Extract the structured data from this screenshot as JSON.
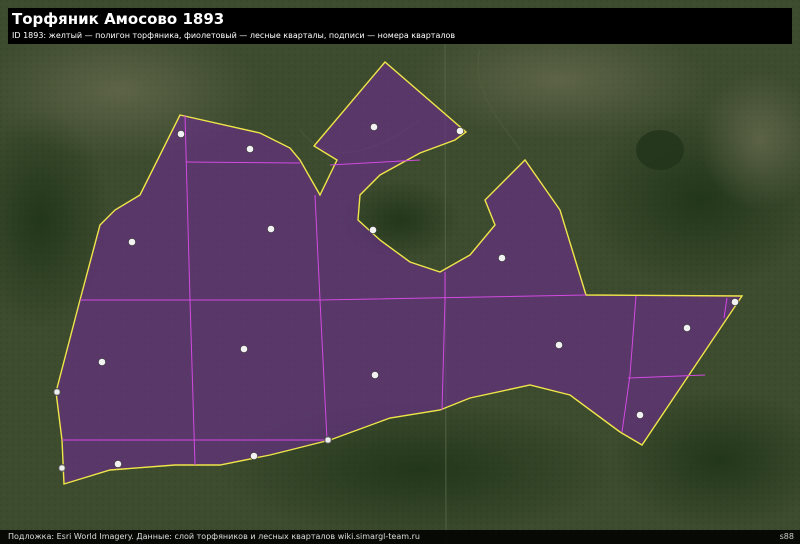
{
  "header": {
    "title": "Торфяник Амосово 1893",
    "subtitle": "ID 1893: желтый — полигон торфяника, фиолетовый — лесные кварталы, подписи — номера кварталов"
  },
  "footer": {
    "attribution": "Подложка: Esri World Imagery. Данные: слой торфяников и лесных кварталов wiki.simargl-team.ru",
    "sheet_number": "s88"
  },
  "colors": {
    "peat_outline": "#f0e64a",
    "quarter_lines": "#d24ae0",
    "quarter_fill": "#6a2c8e",
    "imagery_base": "#3b4a2c"
  },
  "quarter_labels": [
    {
      "id": "q-top-left",
      "text": ""
    },
    {
      "id": "q-top-mid",
      "text": ""
    },
    {
      "id": "q-north-lobe",
      "text": ""
    },
    {
      "id": "q-north-lobe-edge",
      "text": ""
    },
    {
      "id": "q-west",
      "text": ""
    },
    {
      "id": "q-mid",
      "text": ""
    },
    {
      "id": "q-notch",
      "text": ""
    },
    {
      "id": "q-east-upper",
      "text": ""
    },
    {
      "id": "q-southwest",
      "text": ""
    },
    {
      "id": "q-central",
      "text": ""
    },
    {
      "id": "q-south-central",
      "text": ""
    },
    {
      "id": "q-east",
      "text": ""
    },
    {
      "id": "q-far-east",
      "text": ""
    },
    {
      "id": "q-far-east-corner",
      "text": ""
    },
    {
      "id": "q-southeast",
      "text": ""
    },
    {
      "id": "q-west-edge",
      "text": ""
    },
    {
      "id": "q-sw-corner",
      "text": ""
    },
    {
      "id": "q-south-left",
      "text": ""
    },
    {
      "id": "q-south-mid",
      "text": ""
    },
    {
      "id": "q-south-junction",
      "text": ""
    }
  ]
}
